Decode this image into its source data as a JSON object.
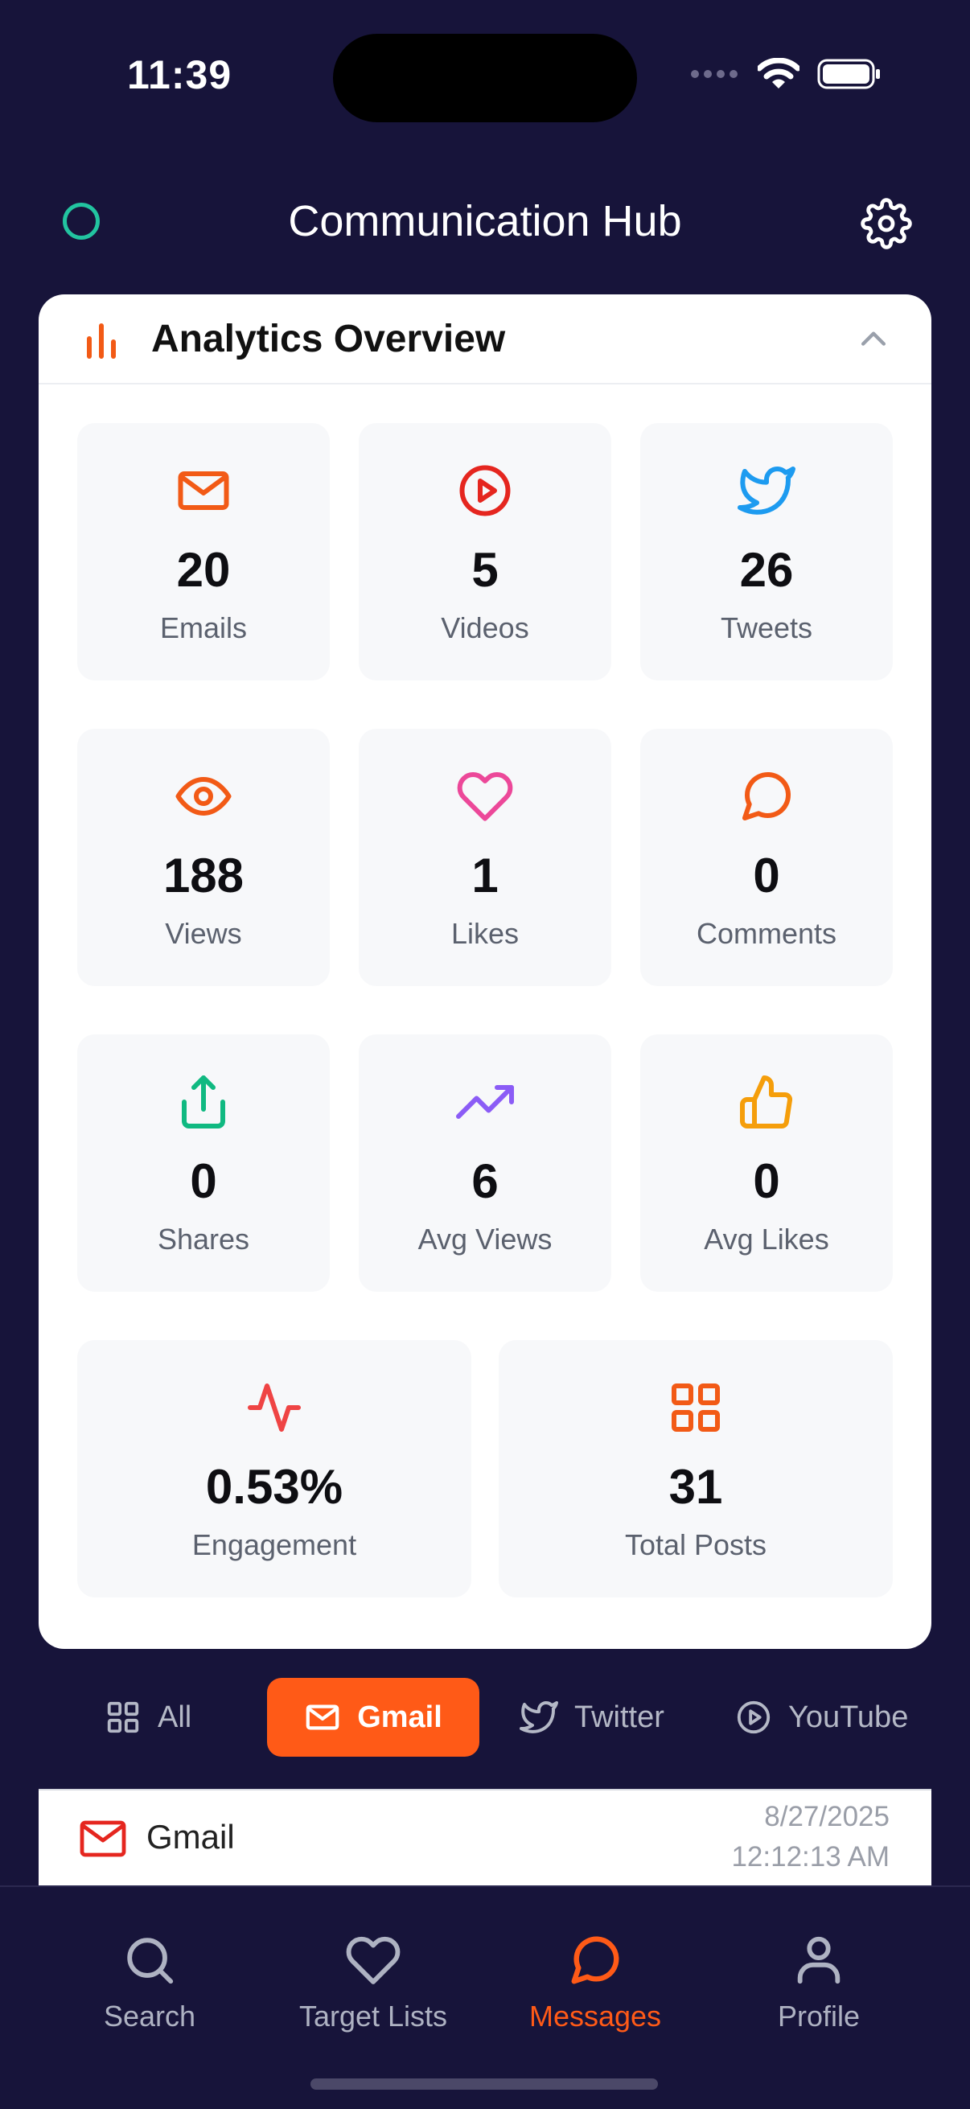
{
  "status_bar": {
    "time": "11:39"
  },
  "header": {
    "title": "Communication Hub"
  },
  "analytics": {
    "title": "Analytics Overview",
    "tiles": [
      {
        "label": "Emails",
        "value": "20",
        "icon": "mail-icon",
        "color": "#f25a16"
      },
      {
        "label": "Videos",
        "value": "5",
        "icon": "play-circle-icon",
        "color": "#e5261f"
      },
      {
        "label": "Tweets",
        "value": "26",
        "icon": "twitter-icon",
        "color": "#1d9bf0"
      },
      {
        "label": "Views",
        "value": "188",
        "icon": "eye-icon",
        "color": "#f25a16"
      },
      {
        "label": "Likes",
        "value": "1",
        "icon": "heart-icon",
        "color": "#ec4899"
      },
      {
        "label": "Comments",
        "value": "0",
        "icon": "comment-icon",
        "color": "#f25a16"
      },
      {
        "label": "Shares",
        "value": "0",
        "icon": "share-icon",
        "color": "#10b981"
      },
      {
        "label": "Avg Views",
        "value": "6",
        "icon": "trending-up-icon",
        "color": "#8b5cf6"
      },
      {
        "label": "Avg Likes",
        "value": "0",
        "icon": "thumbs-up-icon",
        "color": "#f59e0b"
      },
      {
        "label": "Engagement",
        "value": "0.53%",
        "icon": "activity-icon",
        "color": "#ef4444"
      },
      {
        "label": "Total Posts",
        "value": "31",
        "icon": "grid-icon",
        "color": "#f25a16"
      }
    ]
  },
  "filter_tabs": [
    {
      "label": "All",
      "icon": "grid-icon",
      "active": false
    },
    {
      "label": "Gmail",
      "icon": "mail-icon",
      "active": true
    },
    {
      "label": "Twitter",
      "icon": "twitter-icon",
      "active": false
    },
    {
      "label": "YouTube",
      "icon": "play-circle-icon",
      "active": false
    }
  ],
  "messages": [
    {
      "source": "Gmail",
      "date": "8/27/2025",
      "time": "12:12:13 AM"
    }
  ],
  "bottom_nav": [
    {
      "label": "Search",
      "icon": "search-icon",
      "active": false
    },
    {
      "label": "Target Lists",
      "icon": "heart-icon",
      "active": false
    },
    {
      "label": "Messages",
      "icon": "chat-bubble-icon",
      "active": true
    },
    {
      "label": "Profile",
      "icon": "user-icon",
      "active": false
    }
  ],
  "colors": {
    "background": "#17143a",
    "accent": "#ff5a17",
    "card": "#ffffff",
    "tile": "#f7f8fa"
  }
}
